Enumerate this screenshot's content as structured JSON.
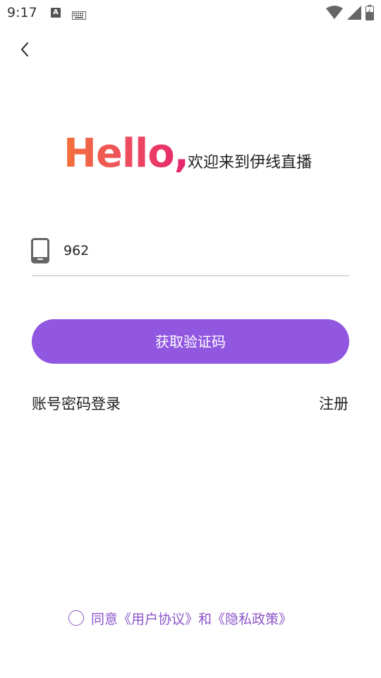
{
  "status_bar": {
    "time": "9:17",
    "a_badge": "A",
    "icons": [
      "a-badge-icon",
      "keyboard-icon",
      "wifi-icon",
      "signal-icon",
      "battery-charging-icon"
    ]
  },
  "nav": {
    "back_icon": "chevron-left-icon"
  },
  "greeting": {
    "hello": "Hello,",
    "subtitle": "欢迎来到伊线直播",
    "gradient": [
      "#f37239",
      "#e5246f"
    ]
  },
  "phone_field": {
    "icon": "smartphone-icon",
    "value": "962"
  },
  "buttons": {
    "get_code": "获取验证码",
    "password_login": "账号密码登录",
    "register": "注册"
  },
  "agreement": {
    "prefix": "同意",
    "user_agreement": "《用户协议》",
    "conjunction": "和",
    "privacy_policy": "《隐私政策》"
  },
  "colors": {
    "primary": "#9157e0",
    "agreement_text": "#8c55c9",
    "divider": "#bdbdbd"
  }
}
